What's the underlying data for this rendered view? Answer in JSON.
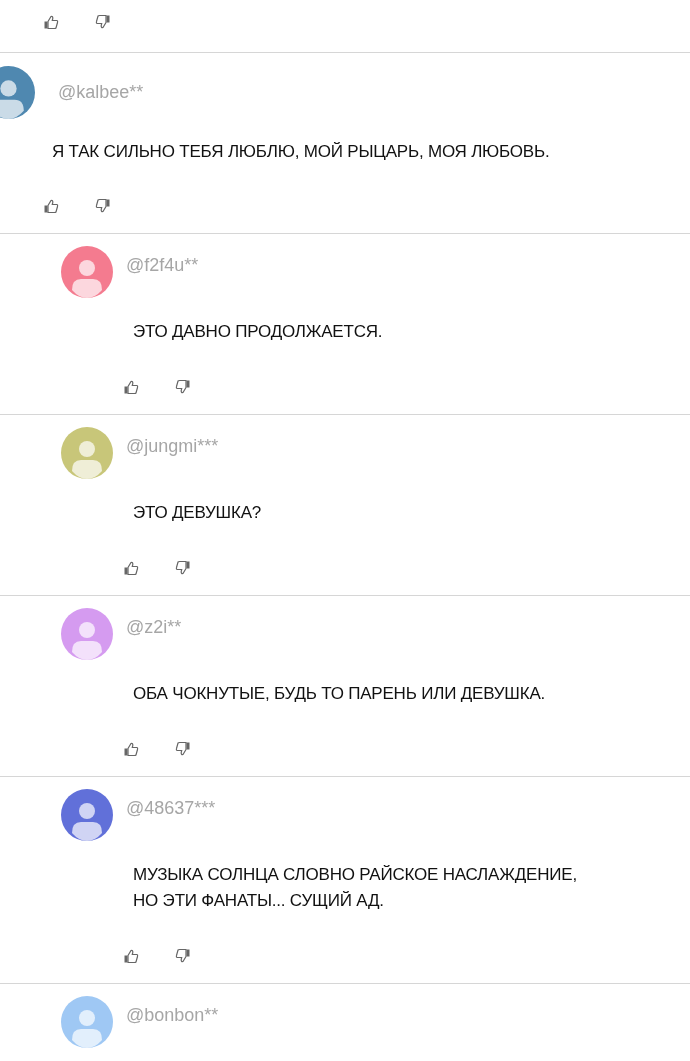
{
  "comments": [
    {
      "kind": "tail"
    },
    {
      "kind": "comment",
      "author": "@kalbee**",
      "color": "#4f88b0",
      "text": "Я ТАК СИЛЬНО ТЕБЯ ЛЮБЛЮ, МОЙ РЫЦАРЬ, МОЯ ЛЮБОВЬ."
    },
    {
      "kind": "reply",
      "author": "@f2f4u**",
      "color": "#f47b8f",
      "text": "ЭТО ДАВНО ПРОДОЛЖАЕТСЯ."
    },
    {
      "kind": "reply",
      "author": "@jungmi***",
      "color": "#c8c679",
      "text": "ЭТО ДЕВУШКА?"
    },
    {
      "kind": "reply",
      "author": "@z2i**",
      "color": "#d59bf0",
      "text": "ОБА ЧОКНУТЫЕ, БУДЬ ТО ПАРЕНЬ ИЛИ ДЕВУШКА."
    },
    {
      "kind": "reply",
      "author": "@48637***",
      "color": "#6170d9",
      "text": "МУЗЫКА СОЛНЦА СЛОВНО РАЙСКОЕ НАСЛАЖДЕНИЕ, НО ЭТИ ФАНАТЫ... СУЩИЙ АД."
    },
    {
      "kind": "partial",
      "author": "@bonbon**",
      "color": "#9fc8f4"
    }
  ]
}
